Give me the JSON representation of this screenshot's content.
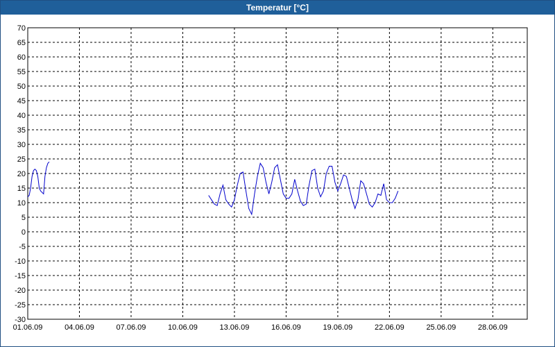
{
  "window": {
    "title": "Temperatur [°C]"
  },
  "chart_data": {
    "type": "line",
    "title": "Temperatur [°C]",
    "xlabel": "",
    "ylabel": "",
    "ylim": [
      -30,
      70
    ],
    "y_ticks": [
      70,
      65,
      60,
      55,
      50,
      45,
      40,
      35,
      30,
      25,
      20,
      15,
      10,
      5,
      0,
      -5,
      -10,
      -15,
      -20,
      -25,
      -30
    ],
    "x_tick_labels": [
      "01.06.09",
      "04.06.09",
      "07.06.09",
      "10.06.09",
      "13.06.09",
      "16.06.09",
      "19.06.09",
      "22.06.09",
      "25.06.09",
      "28.06.09"
    ],
    "xlim": [
      "01.06.09",
      "30.06.09"
    ],
    "grid": true,
    "series": [
      {
        "color": "#0000cc",
        "segments": [
          [
            [
              "01.06.09 00:00",
              12
            ],
            [
              "01.06.09 02:00",
              12.5
            ],
            [
              "01.06.09 04:00",
              15
            ],
            [
              "01.06.09 06:00",
              19
            ],
            [
              "01.06.09 08:00",
              21
            ],
            [
              "01.06.09 10:00",
              21.5
            ],
            [
              "01.06.09 12:00",
              21
            ],
            [
              "01.06.09 14:00",
              19
            ],
            [
              "01.06.09 16:00",
              15
            ],
            [
              "01.06.09 18:00",
              14
            ],
            [
              "01.06.09 20:00",
              13.5
            ],
            [
              "01.06.09 22:00",
              13
            ],
            [
              "02.06.09 00:00",
              19
            ],
            [
              "02.06.09 02:00",
              22
            ],
            [
              "02.06.09 04:00",
              23.5
            ],
            [
              "02.06.09 06:00",
              24
            ]
          ],
          [
            [
              "11.06.09 12:00",
              12.5
            ],
            [
              "11.06.09 16:00",
              11
            ],
            [
              "11.06.09 20:00",
              9.5
            ],
            [
              "12.06.09 00:00",
              9
            ],
            [
              "12.06.09 04:00",
              13
            ],
            [
              "12.06.09 08:00",
              16
            ],
            [
              "12.06.09 12:00",
              11
            ],
            [
              "12.06.09 16:00",
              9.5
            ],
            [
              "12.06.09 20:00",
              8.5
            ],
            [
              "13.06.09 00:00",
              11
            ],
            [
              "13.06.09 04:00",
              16
            ],
            [
              "13.06.09 08:00",
              20
            ],
            [
              "13.06.09 12:00",
              20.5
            ],
            [
              "13.06.09 16:00",
              14
            ],
            [
              "13.06.09 20:00",
              8
            ],
            [
              "14.06.09 00:00",
              6
            ],
            [
              "14.06.09 04:00",
              13
            ],
            [
              "14.06.09 08:00",
              19
            ],
            [
              "14.06.09 12:00",
              23.5
            ],
            [
              "14.06.09 16:00",
              22
            ],
            [
              "14.06.09 20:00",
              17
            ],
            [
              "15.06.09 00:00",
              13
            ],
            [
              "15.06.09 04:00",
              17
            ],
            [
              "15.06.09 08:00",
              22
            ],
            [
              "15.06.09 12:00",
              23
            ],
            [
              "15.06.09 16:00",
              18
            ],
            [
              "15.06.09 20:00",
              13
            ],
            [
              "16.06.09 00:00",
              11.5
            ],
            [
              "16.06.09 04:00",
              11.5
            ],
            [
              "16.06.09 08:00",
              13
            ],
            [
              "16.06.09 12:00",
              18
            ],
            [
              "16.06.09 16:00",
              14
            ],
            [
              "16.06.09 20:00",
              10.5
            ],
            [
              "17.06.09 00:00",
              9
            ],
            [
              "17.06.09 04:00",
              9.5
            ],
            [
              "17.06.09 08:00",
              16
            ],
            [
              "17.06.09 12:00",
              21
            ],
            [
              "17.06.09 16:00",
              21.5
            ],
            [
              "17.06.09 20:00",
              15
            ],
            [
              "18.06.09 00:00",
              12
            ],
            [
              "18.06.09 04:00",
              14
            ],
            [
              "18.06.09 08:00",
              20
            ],
            [
              "18.06.09 12:00",
              22.5
            ],
            [
              "18.06.09 16:00",
              22.5
            ],
            [
              "18.06.09 20:00",
              17
            ],
            [
              "19.06.09 00:00",
              14
            ],
            [
              "19.06.09 04:00",
              16.5
            ],
            [
              "19.06.09 08:00",
              19.5
            ],
            [
              "19.06.09 12:00",
              19
            ],
            [
              "19.06.09 16:00",
              15
            ],
            [
              "19.06.09 20:00",
              11
            ],
            [
              "20.06.09 00:00",
              8
            ],
            [
              "20.06.09 04:00",
              11
            ],
            [
              "20.06.09 08:00",
              17.5
            ],
            [
              "20.06.09 12:00",
              16.5
            ],
            [
              "20.06.09 16:00",
              13
            ],
            [
              "20.06.09 20:00",
              9.5
            ],
            [
              "21.06.09 00:00",
              8.5
            ],
            [
              "21.06.09 04:00",
              10
            ],
            [
              "21.06.09 08:00",
              13
            ],
            [
              "21.06.09 12:00",
              12.5
            ],
            [
              "21.06.09 16:00",
              16.5
            ],
            [
              "21.06.09 20:00",
              11
            ],
            [
              "22.06.09 00:00",
              10
            ],
            [
              "22.06.09 04:00",
              10
            ],
            [
              "22.06.09 08:00",
              11.5
            ],
            [
              "22.06.09 12:00",
              14
            ]
          ]
        ]
      }
    ]
  }
}
